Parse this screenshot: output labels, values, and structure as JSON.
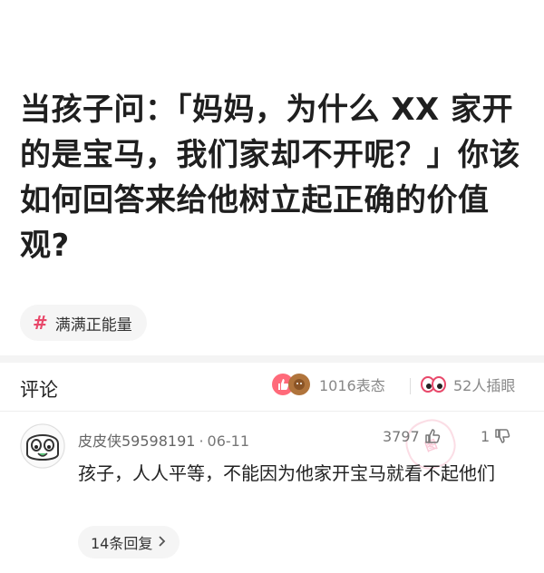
{
  "question": {
    "title": "当孩子问：「妈妈，为什么 XX 家开的是宝马，我们家却不开呢？」你该如何回答来给他树立起正确的价值观?"
  },
  "topic": {
    "hash": "#",
    "label": "满满正能量"
  },
  "comments_header": {
    "title": "评论",
    "reactions_count": "1016表态",
    "insert_image_count": "52人插眼"
  },
  "comment": {
    "username": "皮皮侠59598191",
    "dot": "·",
    "date": "06-11",
    "likes": "3797",
    "dislikes": "1",
    "text": "孩子，人人平等，不能因为他家开宝马就看不起他们",
    "replies": "14条回复",
    "watermark": "图"
  },
  "colors": {
    "accent": "#e8486a",
    "muted": "#888888"
  }
}
